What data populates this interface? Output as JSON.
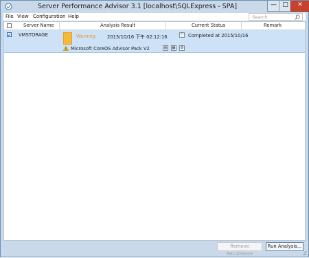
{
  "window": {
    "title": "Server Performance Advisor 3.1 [localhost\\SQLExpress - SPA]"
  },
  "menu": {
    "items": [
      {
        "label": "File"
      },
      {
        "label": "View"
      },
      {
        "label": "Configuration"
      },
      {
        "label": "Help"
      }
    ]
  },
  "search": {
    "placeholder": "Search"
  },
  "table": {
    "columns": [
      "Server Name",
      "Analysis Result",
      "Current Status",
      "Remark"
    ],
    "rows": [
      {
        "checked": true,
        "server_name": "VMSTORAGE",
        "result_level": "Warning",
        "analysis_time": "2015/10/16 下午 02:12:16",
        "status": "Completed at 2015/10/16",
        "remark": "",
        "advisor_pack": "Microsoft CoreOS Advisor Pack V2"
      }
    ]
  },
  "footer": {
    "remove_label": "Remove Recurrence",
    "run_label": "Run Analysis..."
  },
  "colors": {
    "selection": "#cde2f6",
    "warning": "#f7b93a",
    "close": "#c7412e"
  }
}
